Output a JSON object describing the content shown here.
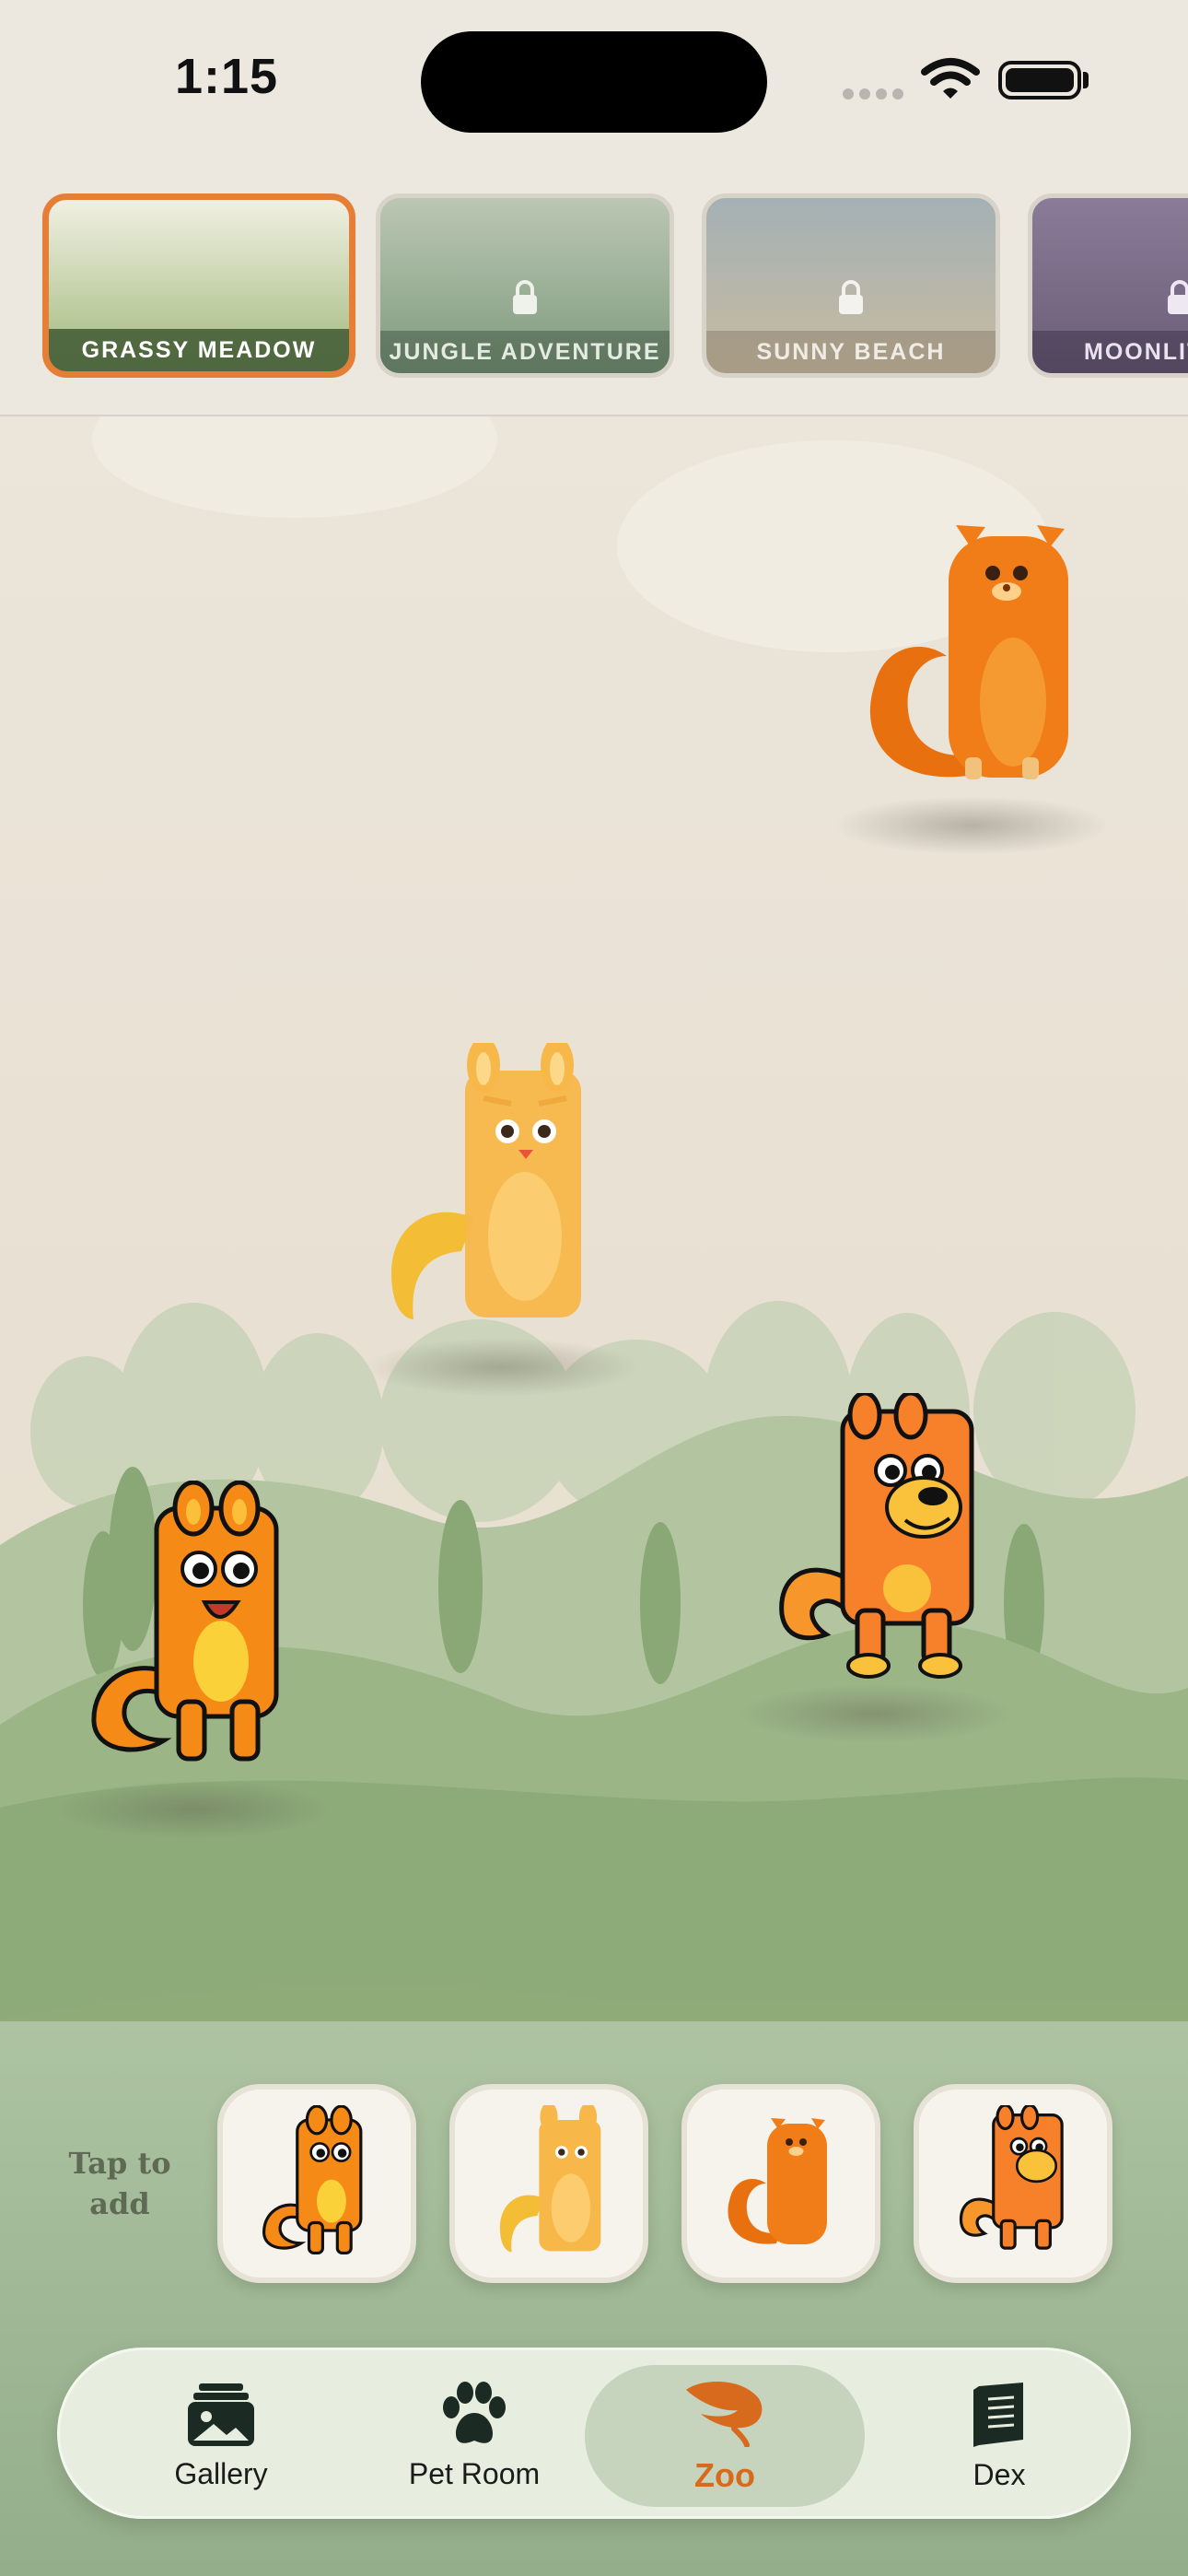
{
  "status_bar": {
    "time": "1:15"
  },
  "habitats": [
    {
      "label": "GRASSY MEADOW",
      "selected": true,
      "locked": false
    },
    {
      "label": "JUNGLE ADVENTURE",
      "selected": false,
      "locked": true
    },
    {
      "label": "SUNNY BEACH",
      "selected": false,
      "locked": true
    },
    {
      "label": "MOONLIT",
      "selected": false,
      "locked": true
    }
  ],
  "tray": {
    "hint": "Tap to add",
    "slot_count": 4
  },
  "tabs": [
    {
      "label": "Gallery",
      "icon": "gallery-icon"
    },
    {
      "label": "Pet Room",
      "icon": "paw-icon"
    },
    {
      "label": "Zoo",
      "icon": "leaf-icon",
      "active": true
    },
    {
      "label": "Dex",
      "icon": "book-icon"
    }
  ],
  "colors": {
    "accent": "#e67e35",
    "active_tab_text": "#d86a1e",
    "grass": "#8fab78",
    "pet_orange": "#f28a1c"
  }
}
